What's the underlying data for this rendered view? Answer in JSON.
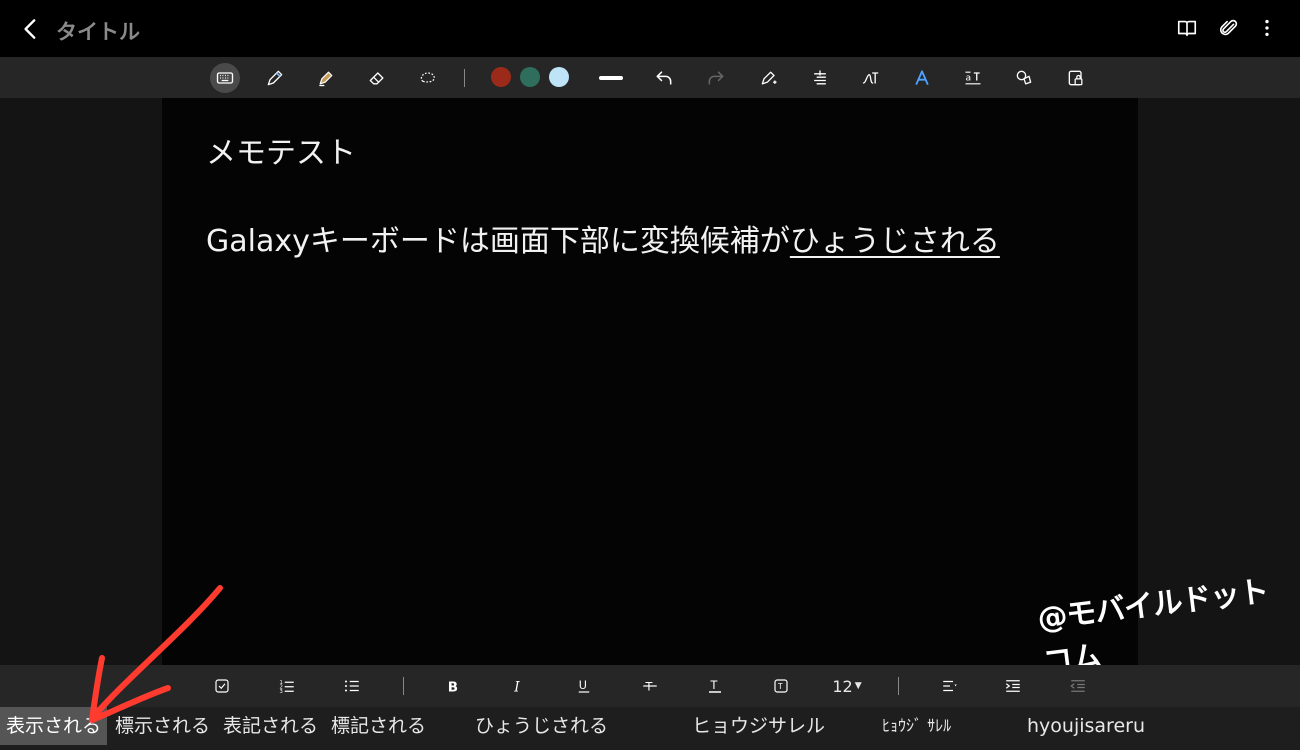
{
  "header": {
    "title": "タイトル",
    "icons": [
      "back-icon",
      "book-icon",
      "attach-icon",
      "more-icon"
    ]
  },
  "pen_toolbar": {
    "tools": [
      "keyboard-icon",
      "pen-icon",
      "highlighter-icon",
      "eraser-icon",
      "lasso-icon",
      "undo-icon",
      "redo-icon",
      "pen-settings-icon",
      "straighten-icon",
      "handwriting-icon",
      "text-style-icon",
      "text-size-icon",
      "shapes-icon",
      "lock-icon"
    ],
    "colors": [
      "#9b2a1a",
      "#2f6e5c",
      "#bfe3f7"
    ],
    "selected_tool": "keyboard-icon"
  },
  "note": {
    "title": "メモテスト",
    "body_committed": "Galaxyキーボードは画面下部に変換候補が",
    "body_composing": "ひょうじされる"
  },
  "watermark": "@モバイルドットコム",
  "format_toolbar": {
    "items": [
      "checkbox-icon",
      "numbered-list-icon",
      "bullet-list-icon",
      "bold-icon",
      "italic-icon",
      "underline-icon",
      "strikethrough-icon",
      "text-color-icon",
      "text-box-icon",
      "align-icon",
      "indent-icon",
      "outdent-icon"
    ],
    "font_size": "12"
  },
  "candidates": {
    "items": [
      "表示される",
      "標示される",
      "表記される",
      "標記される",
      "ひょうじされる",
      "ヒョウジサレル",
      "ﾋｮｳｼﾞ ｻﾚﾙ",
      "hyoujisareru"
    ],
    "selected_index": 0
  },
  "annotation": {
    "arrow_color": "#ff3b30"
  }
}
